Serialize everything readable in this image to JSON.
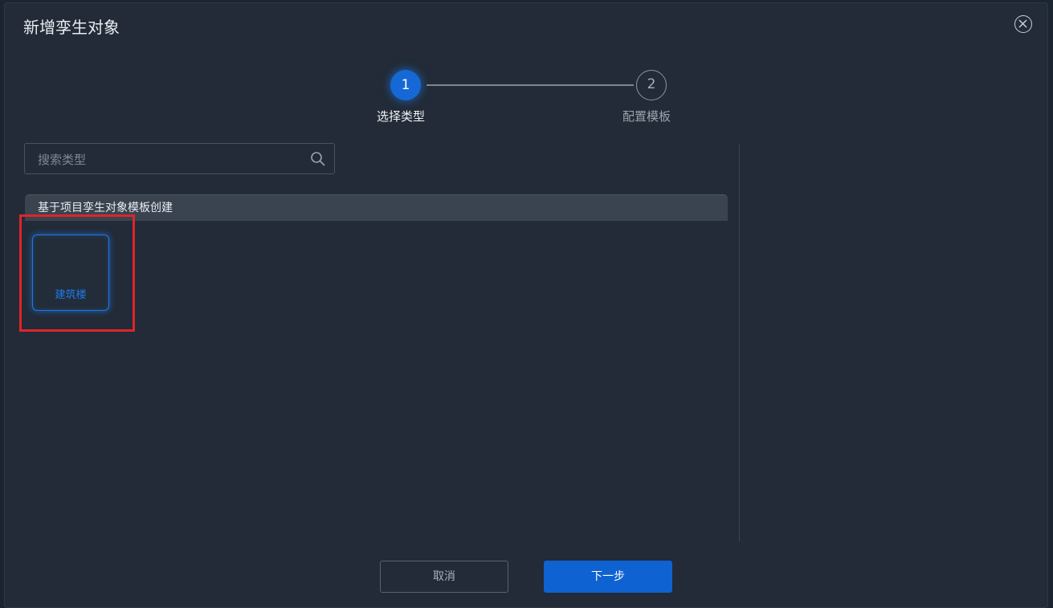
{
  "dialog": {
    "title": "新增孪生对象"
  },
  "steps": [
    {
      "number": "1",
      "label": "选择类型",
      "state": "active"
    },
    {
      "number": "2",
      "label": "配置模板",
      "state": "inactive"
    }
  ],
  "search": {
    "placeholder": "搜索类型",
    "value": ""
  },
  "group": {
    "header": "基于项目孪生对象模板创建",
    "items": [
      {
        "label": "建筑楼",
        "selected": true
      }
    ]
  },
  "footer": {
    "cancel_label": "取消",
    "next_label": "下一步"
  },
  "colors": {
    "accent": "#1668d6",
    "highlight": "#e0242a",
    "panel": "#222b37"
  }
}
